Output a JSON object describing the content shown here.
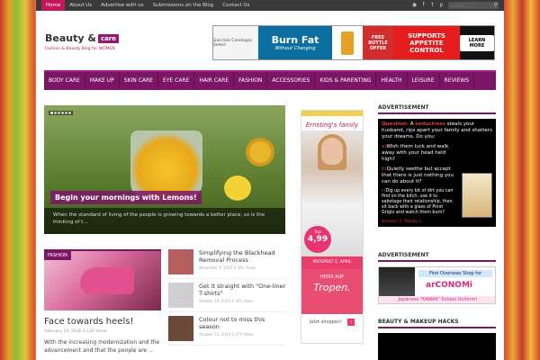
{
  "topbar": {
    "nav": [
      "Home",
      "About Us",
      "Advertise with us",
      "Submissions on the Blog",
      "Contact Us"
    ],
    "search_placeholder": "Search...",
    "icons": [
      "rss-icon",
      "facebook-icon",
      "twitter-icon",
      "pinterest-icon"
    ]
  },
  "logo": {
    "main": "Beauty &",
    "badge": "care",
    "tagline": "Fashion & Beauty Blog for WOMEN"
  },
  "banner": {
    "brand": "Garcinia Cambogia Select",
    "headline": "Burn Fat",
    "sub": "Without Changing",
    "free": "FREE BOTTLE OFFER",
    "supports": [
      "SUPPORTS",
      "APPETITE",
      "CONTROL"
    ],
    "cta": "LEARN MORE"
  },
  "mainnav": [
    "BODY CARE",
    "MAKE UP",
    "SKIN CARE",
    "EYE CARE",
    "HAIR CARE",
    "FASHION",
    "ACCESSORIES",
    "KIDS & PARENTING",
    "HEALTH",
    "LEISURE",
    "REVIEWS"
  ],
  "slider": {
    "title": "Begin your mornings with Lemons!",
    "excerpt": "When the standard of living of the people is growing towards a better place, so is the thinking of t..."
  },
  "featured": {
    "category": "FASHION",
    "title": "Face towards heels!",
    "meta": "February 19, 2016   0   134 Views",
    "excerpt": "With the increasing modernization and the advancement and that the people are ..."
  },
  "small_posts": [
    {
      "title": "Simplifying the Blackhead Removal Process",
      "meta": "November 9, 2015   0   301 Views",
      "thumb": "#b65f5f"
    },
    {
      "title": "Get it straight with \"One-liner T-shirts\"",
      "meta": "October 19, 2015   0   305 Views",
      "thumb": "#cfcfcf"
    },
    {
      "title": "Colour not to miss this season",
      "meta": "October 13, 2015   0   379 Views",
      "thumb": "#6b4a3a"
    }
  ],
  "mid_ad": {
    "brand": "Ernsting's family",
    "price_top": "Top",
    "price": "4,99",
    "prospekt": "PROSPEKT 5. APRIL",
    "heiss": "HEISS AUF",
    "tropen": "Tropen.",
    "shop": "Jetzt shoppen!"
  },
  "sidebar": {
    "ad_heading_1": "ADVERTISEMENT",
    "question_label": "Question:",
    "question_a": "A",
    "question_word": "seductress",
    "question_rest": "steals your husband, rips apart your family and shatters your dreams. Do you:",
    "options": [
      {
        "label": "a)",
        "text": "Wish them luck and walk away with your head held high?"
      },
      {
        "label": "b)",
        "text": "Quietly seethe but accept that there is just nothing you can do about it?"
      },
      {
        "label": "c)",
        "text": "Dig up every bit of dirt you can find on the bitch, use it to sabotage their relationship, then sit back with a glass of Pinot Grigio and watch them burn?"
      }
    ],
    "answer": "Answer: C. Totally C.",
    "ad_heading_2": "ADVERTISEMENT",
    "ad2_line1": "First Overseas Shop for",
    "ad2_brand": "arCONOMi",
    "ad2_line3": "Japanese \"KAWAII\" School Uniform!",
    "heading_3": "BEAUTY & MAKEUP HACKS"
  },
  "colors": {
    "accent": "#7b1667",
    "pink": "#c2185b",
    "topbar": "#3a3a3a"
  }
}
